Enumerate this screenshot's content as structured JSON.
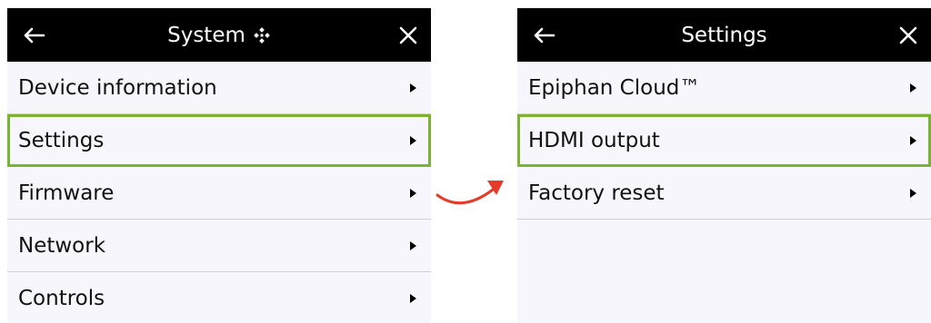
{
  "left": {
    "title": "System",
    "title_icon": "sparkle-icon",
    "back_icon": "arrow-left-icon",
    "close_icon": "close-icon",
    "items": [
      {
        "label": "Device information"
      },
      {
        "label": "Settings",
        "highlighted": true
      },
      {
        "label": "Firmware"
      },
      {
        "label": "Network"
      },
      {
        "label": "Controls"
      }
    ]
  },
  "right": {
    "title": "Settings",
    "back_icon": "arrow-left-icon",
    "close_icon": "close-icon",
    "items": [
      {
        "label": "Epiphan Cloud™"
      },
      {
        "label": "HDMI output",
        "highlighted": true
      },
      {
        "label": "Factory reset"
      }
    ]
  },
  "colors": {
    "header_bg": "#000000",
    "list_bg": "#f6f6fc",
    "highlight": "#7ab532",
    "arrow": "#e53b2a"
  }
}
